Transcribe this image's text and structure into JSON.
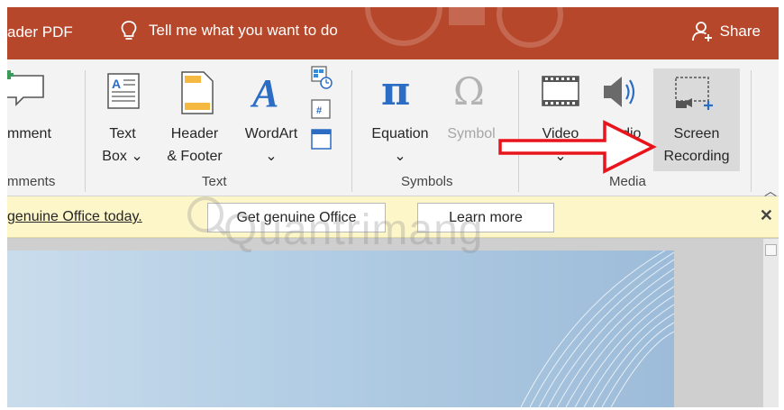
{
  "titlebar": {
    "app_text": "ader PDF",
    "tell_me": "Tell me what you want to do",
    "share": "Share"
  },
  "ribbon": {
    "comment_label": "mment",
    "comments_group": "mments",
    "text_box_line1": "Text",
    "text_box_line2": "Box",
    "header_footer_line1": "Header",
    "header_footer_line2": "& Footer",
    "wordart": "WordArt",
    "text_group": "Text",
    "equation": "Equation",
    "symbol": "Symbol",
    "symbols_group": "Symbols",
    "video": "Video",
    "audio": "Audio",
    "screen_recording_line1": "Screen",
    "screen_recording_line2": "Recording",
    "media_group": "Media",
    "dropdown_glyph": "⌄"
  },
  "message_bar": {
    "link_text": "genuine Office today.",
    "get_genuine_button": "Get genuine Office",
    "learn_more_button": "Learn more",
    "close_glyph": "✕"
  },
  "watermark": {
    "text": "Quantrimang"
  },
  "colors": {
    "title_bar": "#b7472a",
    "ribbon_bg": "#f3f3f3",
    "message_bar_bg": "#fdf6c9",
    "accent_blue": "#2b6cc4",
    "annotation_red": "#e8141c"
  },
  "icons": {
    "lightbulb": "lightbulb-icon",
    "share": "person-add-icon",
    "comment": "comment-icon",
    "text_box": "text-box-icon",
    "header_footer": "header-footer-icon",
    "wordart": "wordart-icon",
    "date_time": "date-time-icon",
    "slide_number": "slide-number-icon",
    "object": "object-icon",
    "equation": "pi-icon",
    "symbol": "omega-icon",
    "video": "film-icon",
    "audio": "speaker-icon",
    "screen_recording": "screen-recording-icon"
  }
}
